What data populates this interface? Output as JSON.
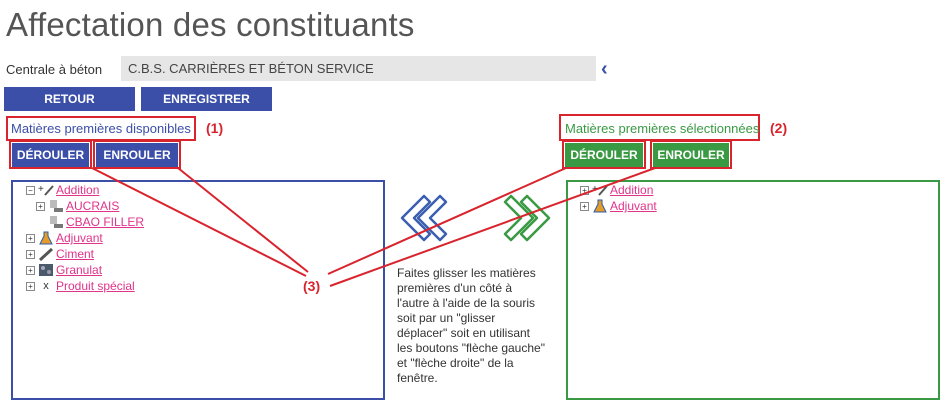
{
  "page": {
    "title": "Affectation des constituants"
  },
  "centrale": {
    "label": "Centrale à béton",
    "value": "C.B.S. CARRIÈRES ET BÉTON SERVICE",
    "back_icon": "chevron-left-icon"
  },
  "toolbar": {
    "retour": "RETOUR",
    "enregistrer": "ENREGISTRER"
  },
  "left": {
    "title": "Matières premières disponibles",
    "annotation": "(1)",
    "derouler": "DÉROULER",
    "enrouler": "ENROULER",
    "items": [
      {
        "label": "Addition",
        "expander": "⊟",
        "icon": "addition-icon"
      },
      {
        "label": "AUCRAIS",
        "expander": "⊞",
        "icon": "silo-icon"
      },
      {
        "label": "CBAO FILLER",
        "expander": "",
        "icon": "silo-icon"
      },
      {
        "label": "Adjuvant",
        "expander": "⊞",
        "icon": "flask-icon"
      },
      {
        "label": "Ciment",
        "expander": "⊞",
        "icon": "cement-icon"
      },
      {
        "label": "Granulat",
        "expander": "⊞",
        "icon": "gravel-icon"
      },
      {
        "label": "Produit spécial",
        "expander": "⊞",
        "icon": "x-icon"
      }
    ]
  },
  "right": {
    "title": "Matières premières sélectionnées",
    "annotation": "(2)",
    "derouler": "DÉROULER",
    "enrouler": "ENROULER",
    "items": [
      {
        "label": "Addition",
        "expander": "⊞",
        "icon": "addition-icon"
      },
      {
        "label": "Adjuvant",
        "expander": "⊞",
        "icon": "flask-icon"
      }
    ]
  },
  "middle": {
    "arrow_left_icon": "double-chevron-left-icon",
    "arrow_right_icon": "double-chevron-right-icon",
    "instructions": "Faites glisser les matières premières d'un côté à l'autre à l'aide de la souris soit par un \"glisser déplacer\" soit en utilisant les boutons \"flèche gauche\" et \"flèche droite\" de la fenêtre."
  },
  "annotation3": "(3)",
  "colors": {
    "blue": "#3b4fa8",
    "green": "#3a9a43",
    "red": "#d9232d",
    "pink": "#e0338a"
  }
}
